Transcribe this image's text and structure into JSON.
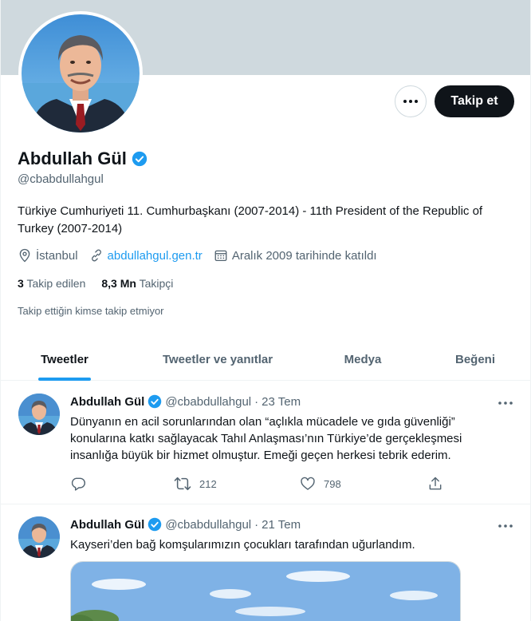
{
  "profile": {
    "name": "Abdullah Gül",
    "handle": "@cbabdullahgul",
    "bio": "Türkiye Cumhuriyeti 11. Cumhurbaşkanı (2007-2014) - 11th President of the Republic of Turkey (2007-2014)",
    "location": "İstanbul",
    "website": "abdullahgul.gen.tr",
    "joined": "Aralık 2009 tarihinde katıldı",
    "following_count": "3",
    "following_label": "Takip edilen",
    "followers_count": "8,3 Mn",
    "followers_label": "Takipçi",
    "followed_by_note": "Takip ettiğin kimse takip etmiyor",
    "follow_button": "Takip et",
    "verified_color": "#1d9bf0"
  },
  "tabs": [
    {
      "label": "Tweetler",
      "active": true
    },
    {
      "label": "Tweetler ve yanıtlar",
      "active": false
    },
    {
      "label": "Medya",
      "active": false
    },
    {
      "label": "Beğeni",
      "active": false
    }
  ],
  "tweets": [
    {
      "name": "Abdullah Gül",
      "handle": "@cbabdullahgul",
      "separator": "·",
      "time": "23 Tem",
      "text": "Dünyanın en acil sorunlarından olan “açlıkla mücadele ve gıda güvenliği” konularına katkı sağlayacak Tahıl Anlaşması’nın Türkiye’de gerçekleşmesi insanlığa büyük bir hizmet olmuştur. Emeği geçen herkesi tebrik ederim.",
      "retweets": "212",
      "likes": "798"
    },
    {
      "name": "Abdullah Gül",
      "handle": "@cbabdullahgul",
      "separator": "·",
      "time": "21 Tem",
      "text": "Kayseri’den bağ komşularımızın çocukları tarafından uğurlandım."
    }
  ],
  "colors": {
    "accent": "#1d9bf0",
    "text_primary": "#0f1419",
    "text_secondary": "#536471",
    "banner": "#cfd9de"
  }
}
